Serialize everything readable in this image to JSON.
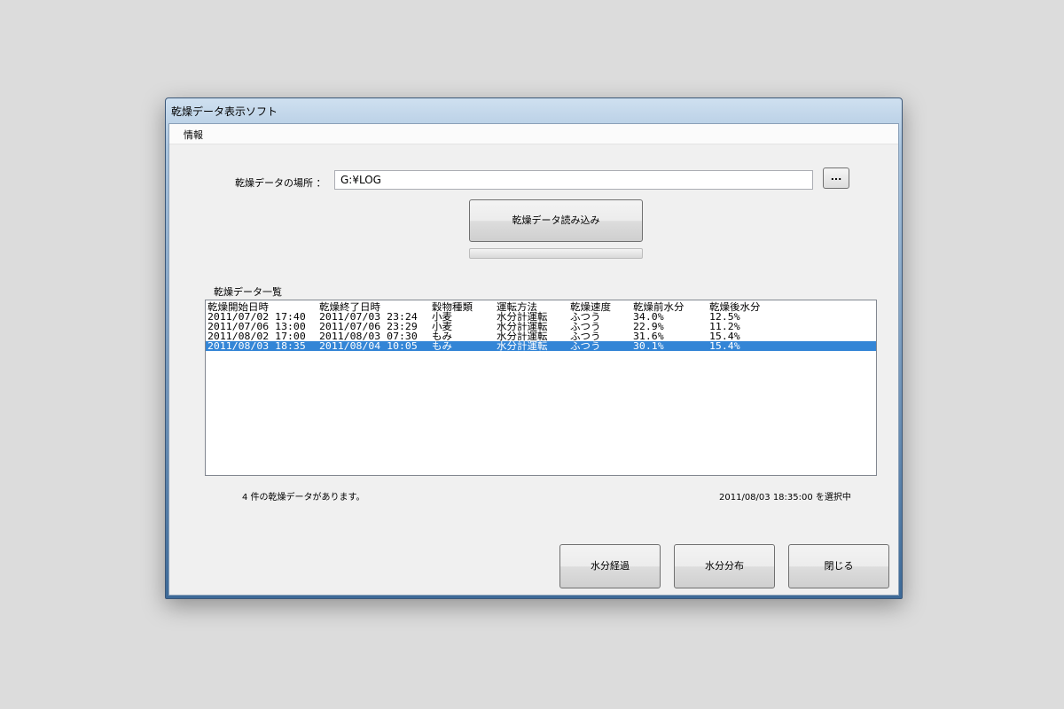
{
  "window": {
    "title": "乾燥データ表示ソフト"
  },
  "menu": {
    "info": "情報"
  },
  "location": {
    "label": "乾燥データの場所 ：",
    "value": "G:¥LOG",
    "browse_label": "..."
  },
  "load_button": "乾燥データ読み込み",
  "progress": {
    "value_percent": 0
  },
  "list": {
    "caption": "乾燥データ一覧",
    "columns": [
      "乾燥開始日時",
      "乾燥終了日時",
      "穀物種類",
      "運転方法",
      "乾燥速度",
      "乾燥前水分",
      "乾燥後水分"
    ],
    "rows": [
      [
        "2011/07/02 17:40",
        "2011/07/03 23:24",
        "小麦",
        "水分計運転",
        "ふつう",
        "34.0%",
        "12.5%"
      ],
      [
        "2011/07/06 13:00",
        "2011/07/06 23:29",
        "小麦",
        "水分計運転",
        "ふつう",
        "22.9%",
        "11.2%"
      ],
      [
        "2011/08/02 17:00",
        "2011/08/03 07:30",
        "もみ",
        "水分計運転",
        "ふつう",
        "31.6%",
        "15.4%"
      ],
      [
        "2011/08/03 18:35",
        "2011/08/04 10:05",
        "もみ",
        "水分計運転",
        "ふつう",
        "30.1%",
        "15.4%"
      ]
    ],
    "selected_index": 3
  },
  "status": {
    "count_text": "4 件の乾燥データがあります。",
    "selection_text": "2011/08/03 18:35:00 を選択中"
  },
  "buttons": {
    "moisture_trend": "水分経過",
    "moisture_distribution": "水分分布",
    "close": "閉じる"
  },
  "colors": {
    "selection": "#3385d6",
    "titlebar": "#6f93b8"
  }
}
